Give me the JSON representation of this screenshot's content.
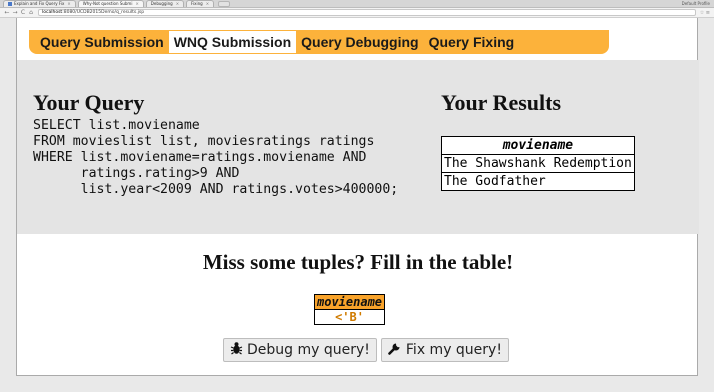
{
  "browser": {
    "tabs": [
      {
        "label": "Explain and Fix Query Fix",
        "active": false
      },
      {
        "label": "Why-Not question Submi",
        "active": true
      },
      {
        "label": "Debugging",
        "active": false
      },
      {
        "label": "Fixing",
        "active": false
      }
    ],
    "profile": "Default Profile",
    "url_host": "localhost",
    "url_rest": ":8080/UCDB2015Demo/q_results.jsp",
    "back": "←",
    "forward": "→",
    "reload": "C",
    "home": "⌂",
    "menu_icons": "☆ ≡"
  },
  "nav": {
    "items": [
      {
        "label": "Query Submission",
        "active": false
      },
      {
        "label": "WNQ Submission",
        "active": true
      },
      {
        "label": "Query Debugging",
        "active": false
      },
      {
        "label": "Query Fixing",
        "active": false
      }
    ]
  },
  "query": {
    "title": "Your Query",
    "sql": "SELECT list.moviename\nFROM movieslist list, moviesratings ratings\nWHERE list.moviename=ratings.moviename AND\n      ratings.rating>9 AND\n      list.year<2009 AND ratings.votes>400000;"
  },
  "results": {
    "title": "Your Results",
    "header": "moviename",
    "rows": [
      "The Shawshank Redemption",
      "The Godfather"
    ]
  },
  "missing": {
    "title": "Miss some tuples? Fill in the table!",
    "header": "moviename",
    "value": "<'B'"
  },
  "buttons": {
    "debug": {
      "label": "Debug my query!",
      "icon": "bug-icon"
    },
    "fix": {
      "label": "Fix my query!",
      "icon": "wrench-icon"
    }
  }
}
